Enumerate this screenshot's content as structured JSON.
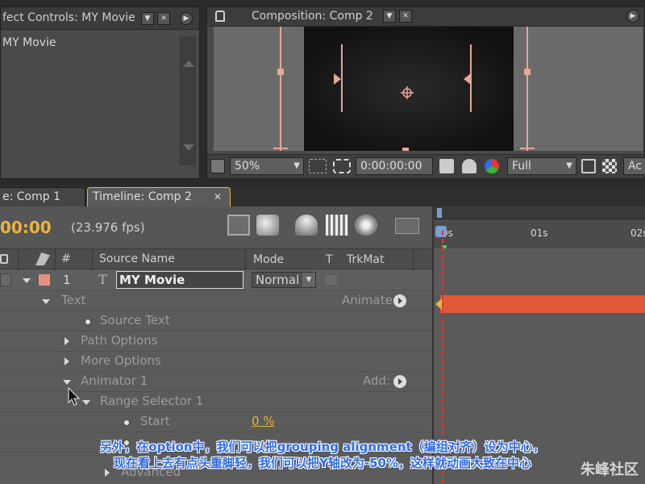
{
  "effect_controls": {
    "tab_title": "fect Controls: MY Movie",
    "layer_name": "MY Movie"
  },
  "composition": {
    "tab_title": "Composition: Comp 2",
    "zoom": "50%",
    "timecode": "0:00:00:00",
    "resolution": "Full",
    "overflow_label": "Ac"
  },
  "timeline": {
    "tabs": [
      {
        "label": "e: Comp 1"
      },
      {
        "label": "Timeline: Comp 2"
      }
    ],
    "current_time": "00:00",
    "fps": "(23.976 fps)",
    "columns": {
      "num": "#",
      "source_name": "Source Name",
      "mode": "Mode",
      "t": "T",
      "trkmat": "TrkMat"
    },
    "layer": {
      "number": "1",
      "name": "MY Movie",
      "mode": "Normal"
    },
    "rows": {
      "text": "Text",
      "animate_label": "Animate:",
      "source_text": "Source Text",
      "path_options": "Path Options",
      "more_options": "More Options",
      "animator": "Animator 1",
      "add_label": "Add:",
      "range_selector": "Range Selector 1",
      "start": "Start",
      "start_value": "0 %",
      "advanced": "Advanced"
    },
    "ruler": [
      "0s",
      "01s",
      "02s"
    ],
    "layer_color": "#e05a3a",
    "label_color": "#e89080"
  },
  "subtitles": {
    "line1": "另外，在option中，我们可以把grouping alignment（编组对齐）设为中心，",
    "line2": "现在看上去有点头重脚轻，我们可以把Y轴改为-50%，这样就动画大致在中心"
  },
  "watermark": "朱峰社区"
}
